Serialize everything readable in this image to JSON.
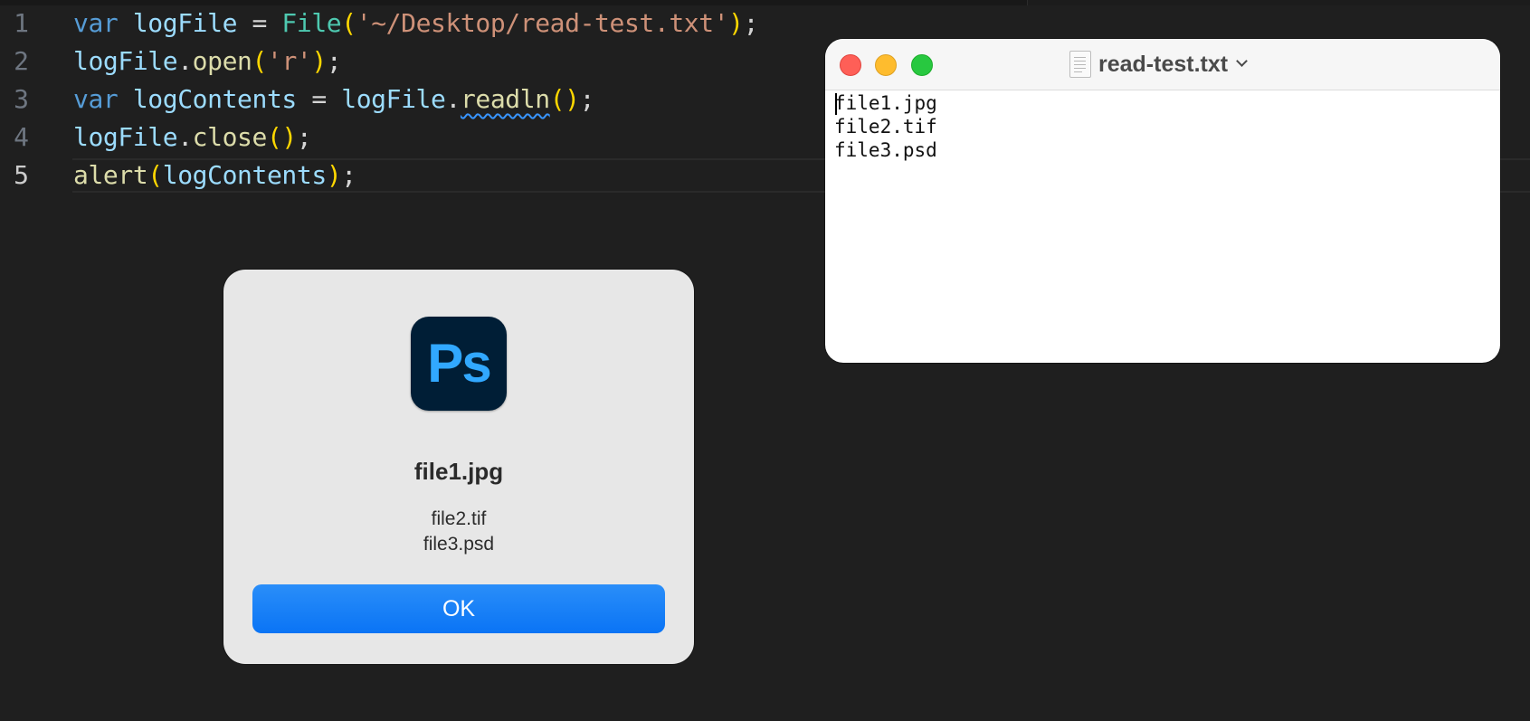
{
  "editor": {
    "line_numbers": [
      "1",
      "2",
      "3",
      "4",
      "5"
    ],
    "current_line": 5,
    "lines": [
      [
        {
          "t": "var",
          "c": "kw"
        },
        {
          "t": " ",
          "c": "pun"
        },
        {
          "t": "logFile",
          "c": "var"
        },
        {
          "t": " = ",
          "c": "pun"
        },
        {
          "t": "File",
          "c": "cls"
        },
        {
          "t": "(",
          "c": "br"
        },
        {
          "t": "'~/Desktop/read-test.txt'",
          "c": "str"
        },
        {
          "t": ")",
          "c": "br"
        },
        {
          "t": ";",
          "c": "pun"
        }
      ],
      [
        {
          "t": "logFile",
          "c": "var"
        },
        {
          "t": ".",
          "c": "pun"
        },
        {
          "t": "open",
          "c": "fn"
        },
        {
          "t": "(",
          "c": "br"
        },
        {
          "t": "'r'",
          "c": "str"
        },
        {
          "t": ")",
          "c": "br"
        },
        {
          "t": ";",
          "c": "pun"
        }
      ],
      [
        {
          "t": "var",
          "c": "kw"
        },
        {
          "t": " ",
          "c": "pun"
        },
        {
          "t": "logContents",
          "c": "var"
        },
        {
          "t": " = ",
          "c": "pun"
        },
        {
          "t": "logFile",
          "c": "var"
        },
        {
          "t": ".",
          "c": "pun"
        },
        {
          "t": "readln",
          "c": "fn squig"
        },
        {
          "t": "()",
          "c": "br"
        },
        {
          "t": ";",
          "c": "pun"
        }
      ],
      [
        {
          "t": "logFile",
          "c": "var"
        },
        {
          "t": ".",
          "c": "pun"
        },
        {
          "t": "close",
          "c": "fn"
        },
        {
          "t": "()",
          "c": "br"
        },
        {
          "t": ";",
          "c": "pun"
        }
      ],
      [
        {
          "t": "alert",
          "c": "fn"
        },
        {
          "t": "(",
          "c": "br"
        },
        {
          "t": "logContents",
          "c": "var"
        },
        {
          "t": ")",
          "c": "br"
        },
        {
          "t": ";",
          "c": "pun"
        }
      ]
    ]
  },
  "textedit": {
    "title": "read-test.txt",
    "icon": "document-icon",
    "lines": [
      "file1.jpg",
      "file2.tif",
      "file3.psd"
    ]
  },
  "alert": {
    "app_icon_text": "Ps",
    "title": "file1.jpg",
    "message_lines": [
      "file2.tif",
      "file3.psd"
    ],
    "ok_label": "OK"
  },
  "colors": {
    "editor_bg": "#1f1f1f",
    "keyword": "#569cd6",
    "variable": "#9cdcfe",
    "class": "#4ec9b0",
    "function": "#dcdcaa",
    "string": "#ce9178",
    "bracket": "#ffd700",
    "ps_icon_bg": "#001e36",
    "ps_icon_text": "#31a8ff",
    "ok_button": "#0a74f5"
  }
}
